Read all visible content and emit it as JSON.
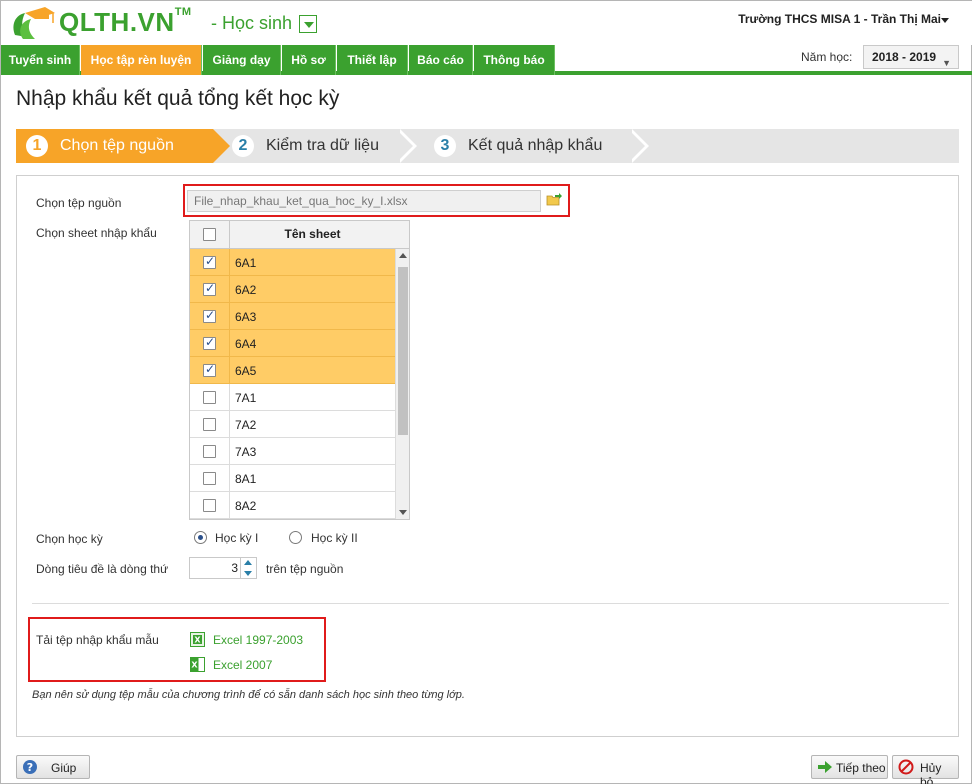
{
  "app": {
    "brand": "QLTH.VN",
    "brand_tm": "TM",
    "role": "- Học sinh",
    "user": "Trường THCS MISA 1 - Trần Thị Mai"
  },
  "nav": {
    "tabs": [
      {
        "label": "Tuyển sinh"
      },
      {
        "label": "Học tập rèn luyện"
      },
      {
        "label": "Giảng dạy"
      },
      {
        "label": "Hồ sơ"
      },
      {
        "label": "Thiết lập"
      },
      {
        "label": "Báo cáo"
      },
      {
        "label": "Thông báo"
      }
    ],
    "active_tab": "Học tập rèn luyện",
    "year_label": "Năm học:",
    "year_value": "2018 - 2019"
  },
  "page": {
    "title": "Nhập khẩu kết quả tổng kết học kỳ"
  },
  "wizard": {
    "steps": [
      {
        "num": "1",
        "label": "Chọn tệp nguồn"
      },
      {
        "num": "2",
        "label": "Kiểm tra dữ liệu"
      },
      {
        "num": "3",
        "label": "Kết quả nhập khẩu"
      }
    ],
    "active_step": 1
  },
  "form": {
    "source_label": "Chọn tệp nguồn",
    "source_value": "File_nhap_khau_ket_qua_hoc_ky_I.xlsx",
    "sheet_label": "Chọn sheet nhập khẩu",
    "sheet_header": "Tên sheet",
    "sheets": [
      {
        "name": "6A1",
        "checked": true
      },
      {
        "name": "6A2",
        "checked": true
      },
      {
        "name": "6A3",
        "checked": true
      },
      {
        "name": "6A4",
        "checked": true
      },
      {
        "name": "6A5",
        "checked": true
      },
      {
        "name": "7A1",
        "checked": false
      },
      {
        "name": "7A2",
        "checked": false
      },
      {
        "name": "7A3",
        "checked": false
      },
      {
        "name": "8A1",
        "checked": false
      },
      {
        "name": "8A2",
        "checked": false
      }
    ],
    "semester_label": "Chọn học kỳ",
    "semester_options": [
      "Học kỳ I",
      "Học kỳ II"
    ],
    "semester_selected": "Học kỳ I",
    "header_row_label": "Dòng tiêu đề là dòng thứ",
    "header_row_value": "3",
    "header_row_suffix": "trên tệp nguồn",
    "template_label": "Tải tệp nhập khẩu mẫu",
    "template_links": [
      "Excel 1997-2003",
      "Excel 2007"
    ],
    "hint": "Bạn nên sử dụng tệp mẫu của chương trình để có sẵn danh sách học sinh theo từng lớp."
  },
  "footer": {
    "help": "Giúp",
    "next": "Tiếp theo",
    "cancel": "Hủy bỏ"
  },
  "colors": {
    "brand_green": "#3ba12f",
    "accent_orange": "#f7a428",
    "selected_row": "#ffcc66",
    "highlight_red": "#e01b1b"
  }
}
